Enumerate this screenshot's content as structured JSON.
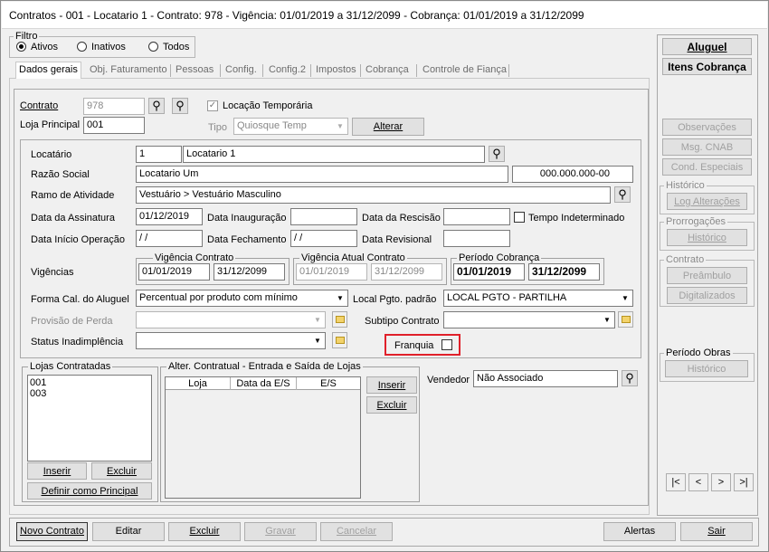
{
  "window": {
    "title": "Contratos - 001 - Locatario 1 - Contrato: 978 - Vigência: 01/01/2019 a 31/12/2099 - Cobrança: 01/01/2019 a 31/12/2099"
  },
  "filter": {
    "label": "Filtro",
    "options": [
      "Ativos",
      "Inativos",
      "Todos"
    ],
    "selected": "Ativos"
  },
  "tabs": [
    "Dados gerais",
    "Obj. Faturamento",
    "Pessoas",
    "Config.",
    "Config.2",
    "Impostos",
    "Cobrança",
    "Controle de Fiança"
  ],
  "active_tab": "Dados gerais",
  "contract": {
    "contrato_label": "Contrato",
    "contrato_value": "978",
    "locacao_temporaria_label": "Locação Temporária",
    "locacao_temporaria_checked": true,
    "loja_principal_label": "Loja Principal",
    "loja_principal_value": "001",
    "tipo_label": "Tipo",
    "tipo_value": "Quiosque Temp",
    "alterar_label": "Alterar"
  },
  "details": {
    "locatario_label": "Locatário",
    "locatario_code": "1",
    "locatario_name": "Locatario 1",
    "razao_social_label": "Razão Social",
    "razao_social_value": "Locatario Um",
    "cnpj_value": "000.000.000-00",
    "ramo_label": "Ramo de Atividade",
    "ramo_value": "Vestuário > Vestuário Masculino",
    "data_assinatura_label": "Data da Assinatura",
    "data_assinatura_value": "01/12/2019",
    "data_inauguracao_label": "Data Inauguração",
    "data_inauguracao_value": "",
    "data_rescisao_label": "Data da Rescisão",
    "data_rescisao_value": "",
    "tempo_indeterminado_label": "Tempo Indeterminado",
    "data_inicio_label": "Data Início Operação",
    "data_inicio_value": " / /",
    "data_fechamento_label": "Data Fechamento",
    "data_fechamento_value": " / /",
    "data_revisional_label": "Data Revisional",
    "data_revisional_value": "",
    "vigencias_label": "Vigências",
    "vigencia_contrato_label": "Vigência Contrato",
    "vigencia_contrato_inicio": "01/01/2019",
    "vigencia_contrato_fim": "31/12/2099",
    "vigencia_atual_label": "Vigência Atual Contrato",
    "vigencia_atual_inicio": "01/01/2019",
    "vigencia_atual_fim": "31/12/2099",
    "periodo_cobranca_label": "Período Cobrança",
    "periodo_cobranca_inicio": "01/01/2019",
    "periodo_cobranca_fim": "31/12/2099",
    "forma_cal_label": "Forma Cal. do Aluguel",
    "forma_cal_value": "Percentual por produto com mínimo",
    "local_pgto_label": "Local Pgto. padrão",
    "local_pgto_value": "LOCAL PGTO - PARTILHA",
    "provisao_label": "Provisão de Perda",
    "provisao_value": "",
    "subtipo_label": "Subtipo Contrato",
    "subtipo_value": "",
    "status_label": "Status Inadimplência",
    "status_value": "",
    "franquia_label": "Franquia"
  },
  "lojas": {
    "title": "Lojas Contratadas",
    "items": [
      "001",
      "003"
    ],
    "inserir": "Inserir",
    "excluir": "Excluir",
    "definir": "Definir como Principal"
  },
  "alter": {
    "title": "Alter. Contratual - Entrada e Saída de Lojas",
    "columns": [
      "Loja",
      "Data da E/S",
      "E/S"
    ],
    "inserir": "Inserir",
    "excluir": "Excluir"
  },
  "vendedor": {
    "label": "Vendedor",
    "value": "Não Associado"
  },
  "side": {
    "aluguel": "Aluguel",
    "itens_cobranca": "Itens Cobrança",
    "observacoes": "Observações",
    "msg_cnab": "Msg. CNAB",
    "cond_especiais": "Cond. Especiais",
    "historico_title": "Histórico",
    "log_alteracoes": "Log Alterações",
    "prorrogacoes_title": "Prorrogações",
    "historico_btn": "Histórico",
    "contrato_title": "Contrato",
    "preambulo": "Preâmbulo",
    "digitalizados": "Digitalizados",
    "periodo_obras_title": "Período Obras",
    "historico_obras": "Histórico",
    "nav": [
      "|<",
      "<",
      ">",
      ">|"
    ]
  },
  "bottom": {
    "novo_contrato": "Novo Contrato",
    "editar": "Editar",
    "excluir": "Excluir",
    "gravar": "Gravar",
    "cancelar": "Cancelar",
    "alertas": "Alertas",
    "sair": "Sair"
  },
  "colors": {
    "highlight": "#e0202a"
  }
}
